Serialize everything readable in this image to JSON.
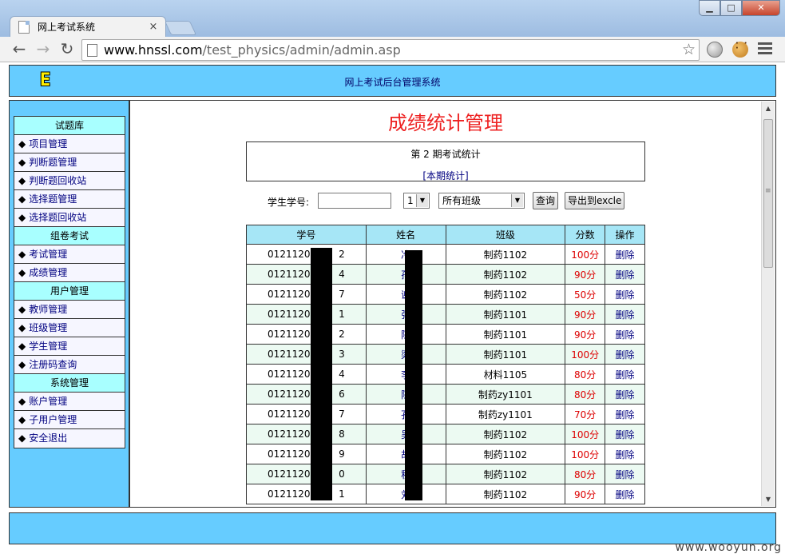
{
  "browser": {
    "tab_title": "网上考试系统",
    "tab_close": "×",
    "url_host": "www.hnssl.com",
    "url_path": "/test_physics/admin/admin.asp",
    "window_buttons": {
      "minimize": "▁",
      "maximize": "□",
      "close": "✕"
    },
    "nav": {
      "back": "←",
      "forward": "→",
      "reload": "↻"
    },
    "star": "☆"
  },
  "header": {
    "logo": "E",
    "system_title": "网上考试后台管理系统"
  },
  "sidebar": {
    "groups": [
      {
        "title": "试题库",
        "items": [
          "项目管理",
          "判断题管理",
          "判断题回收站",
          "选择题管理",
          "选择题回收站"
        ]
      },
      {
        "title": "组卷考试",
        "items": [
          "考试管理",
          "成绩管理"
        ]
      },
      {
        "title": "用户管理",
        "items": [
          "教师管理",
          "班级管理",
          "学生管理",
          "注册码查询"
        ]
      },
      {
        "title": "系统管理",
        "items": [
          "账户管理",
          "子用户管理",
          "安全退出"
        ]
      }
    ],
    "bullet": "◆"
  },
  "main": {
    "heading": "成绩统计管理",
    "period_line": "第 2 期考试统计",
    "period_link": "[本期统计]",
    "filter": {
      "student_id_label": "学生学号:",
      "student_id_value": "",
      "period_select": "1",
      "class_select": "所有班级",
      "query_button": "查询",
      "export_button": "导出到excle"
    },
    "table": {
      "headers": [
        "学号",
        "姓名",
        "班级",
        "分数",
        "操作"
      ],
      "rows": [
        {
          "id_prefix": "01211204",
          "id_suffix": "2",
          "name": "冷",
          "class": "制药1102",
          "score": "100分",
          "op": "删除"
        },
        {
          "id_prefix": "01211204",
          "id_suffix": "4",
          "name": "孙",
          "class": "制药1102",
          "score": "90分",
          "op": "删除"
        },
        {
          "id_prefix": "01211204",
          "id_suffix": "7",
          "name": "谢",
          "class": "制药1102",
          "score": "50分",
          "op": "删除"
        },
        {
          "id_prefix": "01211204",
          "id_suffix": "1",
          "name": "张",
          "class": "制药1101",
          "score": "90分",
          "op": "删除"
        },
        {
          "id_prefix": "01211204",
          "id_suffix": "2",
          "name": "陈",
          "class": "制药1101",
          "score": "90分",
          "op": "删除"
        },
        {
          "id_prefix": "01211204",
          "id_suffix": "3",
          "name": "梁",
          "class": "制药1101",
          "score": "100分",
          "op": "删除"
        },
        {
          "id_prefix": "01211204",
          "id_suffix": "4",
          "name": "李",
          "class": "材料1105",
          "score": "80分",
          "op": "删除"
        },
        {
          "id_prefix": "01211204",
          "id_suffix": "6",
          "name": "陈",
          "class": "制药zy1101",
          "score": "80分",
          "op": "删除"
        },
        {
          "id_prefix": "01211204",
          "id_suffix": "7",
          "name": "孔",
          "class": "制药zy1101",
          "score": "70分",
          "op": "删除"
        },
        {
          "id_prefix": "01211204",
          "id_suffix": "8",
          "name": "吴",
          "class": "制药1102",
          "score": "100分",
          "op": "删除"
        },
        {
          "id_prefix": "01211204",
          "id_suffix": "9",
          "name": "胡",
          "class": "制药1102",
          "score": "100分",
          "op": "删除"
        },
        {
          "id_prefix": "01211204",
          "id_suffix": "0",
          "name": "程",
          "class": "制药1102",
          "score": "80分",
          "op": "删除"
        },
        {
          "id_prefix": "01211204",
          "id_suffix": "1",
          "name": "刘",
          "class": "制药1102",
          "score": "90分",
          "op": "删除"
        }
      ]
    }
  },
  "watermark": "www.wooyun.org"
}
